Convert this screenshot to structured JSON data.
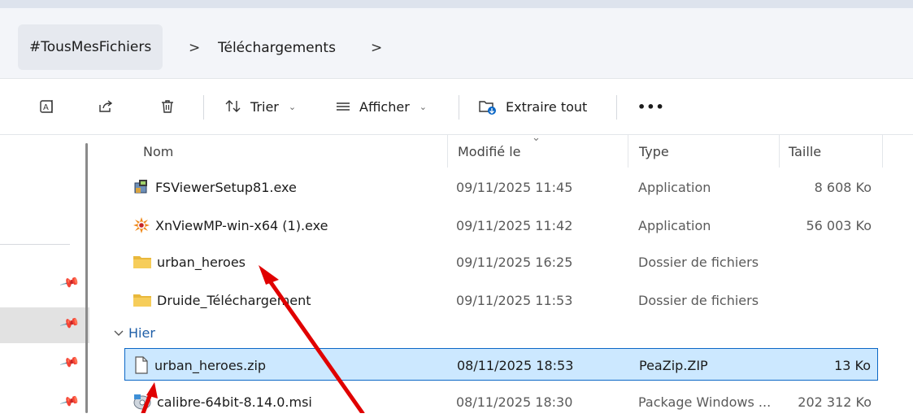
{
  "breadcrumb": {
    "root": "#TousMesFichiers",
    "separator": ">",
    "current": "Téléchargements",
    "trailing": ">"
  },
  "toolbar": {
    "sort_label": "Trier",
    "view_label": "Afficher",
    "extract_label": "Extraire tout",
    "more_label": "•••",
    "chevron": "⌄"
  },
  "columns": {
    "name": "Nom",
    "modified": "Modifié le",
    "type": "Type",
    "size": "Taille"
  },
  "group_yesterday": "Hier",
  "files": [
    {
      "name": "FSViewerSetup81.exe",
      "modified": "09/11/2025 11:45",
      "type": "Application",
      "size": "8 608 Ko",
      "icon": "installer-icon"
    },
    {
      "name": "XnViewMP-win-x64 (1).exe",
      "modified": "09/11/2025 11:42",
      "type": "Application",
      "size": "56 003 Ko",
      "icon": "xnview-icon"
    },
    {
      "name": "urban_heroes",
      "modified": "09/11/2025 16:25",
      "type": "Dossier de fichiers",
      "size": "",
      "icon": "folder-icon"
    },
    {
      "name": "Druide_Téléchargement",
      "modified": "09/11/2025 11:53",
      "type": "Dossier de fichiers",
      "size": "",
      "icon": "folder-icon"
    },
    {
      "name": "urban_heroes.zip",
      "modified": "08/11/2025 18:53",
      "type": "PeaZip.ZIP",
      "size": "13 Ko",
      "icon": "file-icon",
      "selected": true
    },
    {
      "name": "calibre-64bit-8.14.0.msi",
      "modified": "08/11/2025 18:30",
      "type": "Package Windows ...",
      "size": "202 312 Ko",
      "icon": "msi-icon"
    }
  ],
  "colors": {
    "accent": "#0b67c6",
    "selection": "#cce8ff",
    "folder": "#f2c04d",
    "annotation_arrow": "#e00000"
  }
}
